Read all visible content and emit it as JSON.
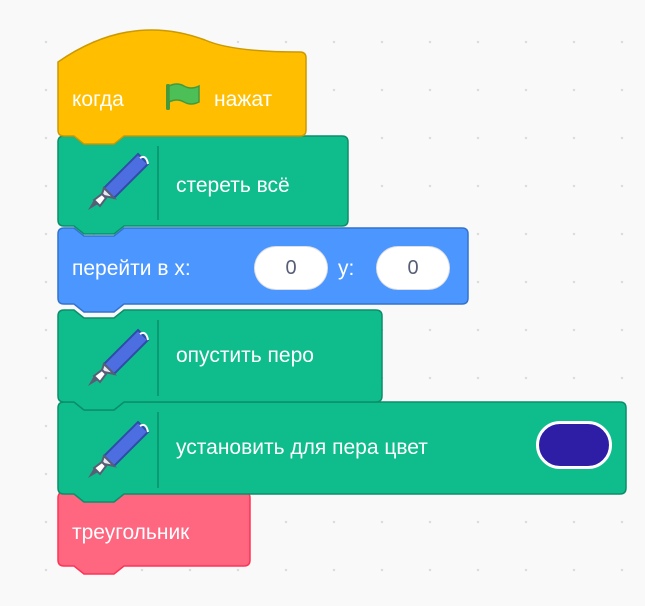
{
  "colors": {
    "events": "#ffbf00",
    "events_border": "#cc9900",
    "pen": "#0fbd8c",
    "pen_border": "#0b8e69",
    "motion": "#4c97ff",
    "motion_border": "#3373cc",
    "custom": "#ff6680",
    "custom_border": "#ff3355",
    "flag": "#4cbf56",
    "pen_color_value": "#2e1ea6"
  },
  "script": {
    "when_flag": {
      "before": "когда",
      "after": "нажат",
      "icon": "green-flag-icon"
    },
    "clear": {
      "label": "стереть всё",
      "icon": "pen-icon"
    },
    "goto": {
      "label": "перейти в x:",
      "x_value": "0",
      "y_label": "y:",
      "y_value": "0"
    },
    "pen_down": {
      "label": "опустить перо",
      "icon": "pen-icon"
    },
    "set_pen_color": {
      "label": "установить для пера цвет",
      "icon": "pen-icon"
    },
    "custom_block": {
      "label": "треугольник"
    }
  }
}
